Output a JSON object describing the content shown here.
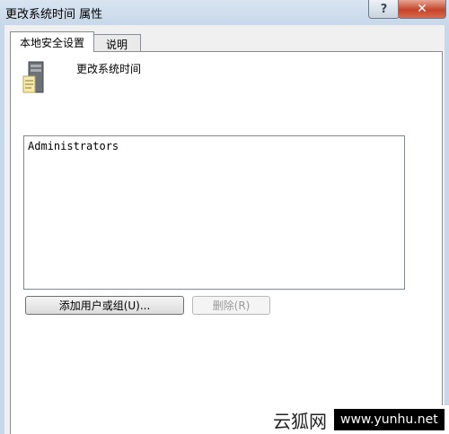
{
  "window": {
    "title": "更改系统时间 属性",
    "help_label": "?",
    "close_label": "✕"
  },
  "tabs": [
    {
      "label": "本地安全设置",
      "active": true
    },
    {
      "label": "说明",
      "active": false
    }
  ],
  "policy": {
    "name": "更改系统时间",
    "icon": "server-policy-icon"
  },
  "principals": {
    "items": [
      "Administrators"
    ]
  },
  "buttons": {
    "add_label": "添加用户或组(U)...",
    "remove_label": "删除(R)",
    "remove_enabled": false
  },
  "watermark": {
    "text": "云狐网",
    "url": "www.yunhu.net"
  }
}
